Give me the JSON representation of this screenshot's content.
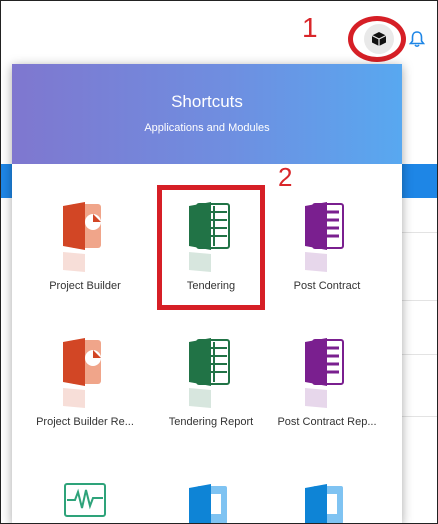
{
  "annotations": {
    "marker_1": "1",
    "marker_2": "2"
  },
  "header": {
    "apps_icon": "cube-icon",
    "notification_icon": "bell-icon"
  },
  "shortcuts": {
    "title": "Shortcuts",
    "subtitle": "Applications and Modules",
    "items": [
      {
        "label": "Project Builder",
        "icon": "powerpoint-app-icon",
        "color": "#d24625"
      },
      {
        "label": "Tendering",
        "icon": "excel-app-icon",
        "color": "#217346"
      },
      {
        "label": "Post Contract",
        "icon": "onenote-app-icon",
        "color": "#7a1f8f"
      },
      {
        "label": "Project Builder Re...",
        "icon": "powerpoint-app-icon",
        "color": "#d24625"
      },
      {
        "label": "Tendering Report",
        "icon": "excel-app-icon",
        "color": "#217346"
      },
      {
        "label": "Post Contract Rep...",
        "icon": "onenote-app-icon",
        "color": "#7a1f8f"
      },
      {
        "label": "",
        "icon": "monitor-app-icon",
        "color": "#2ea37a"
      },
      {
        "label": "",
        "icon": "publisher-app-icon",
        "color": "#0e84d6"
      },
      {
        "label": "",
        "icon": "publisher-app-icon",
        "color": "#0e84d6"
      }
    ]
  },
  "colors": {
    "accent_blue": "#1e86e6",
    "annotation_red": "#d61f26"
  }
}
